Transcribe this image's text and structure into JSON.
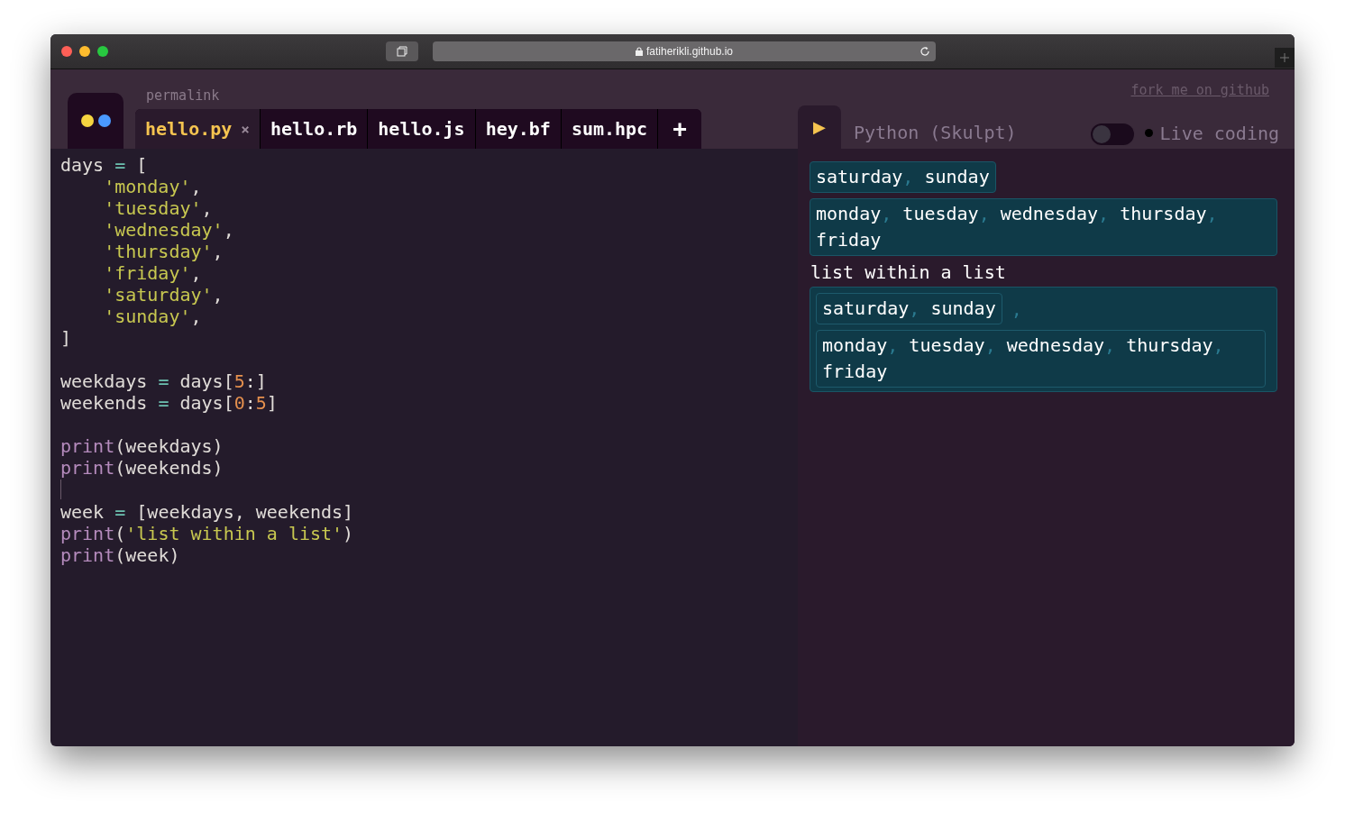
{
  "browser": {
    "address": "fatiherikli.github.io"
  },
  "header": {
    "permalink": "permalink",
    "fork_link": "fork me on github"
  },
  "tabs": [
    {
      "label": "hello.py",
      "selected": true,
      "close": "×"
    },
    {
      "label": "hello.rb",
      "selected": false
    },
    {
      "label": "hello.js",
      "selected": false
    },
    {
      "label": "hey.bf",
      "selected": false
    },
    {
      "label": "sum.hpc",
      "selected": false
    }
  ],
  "add_tab": "+",
  "editor": {
    "lines": [
      {
        "tokens": [
          {
            "kind": "plain",
            "text": "days "
          },
          {
            "kind": "op",
            "text": "="
          },
          {
            "kind": "plain",
            "text": " ["
          }
        ]
      },
      {
        "tokens": [
          {
            "kind": "string",
            "text": "    'monday'"
          },
          {
            "kind": "plain",
            "text": ","
          }
        ]
      },
      {
        "tokens": [
          {
            "kind": "string",
            "text": "    'tuesday'"
          },
          {
            "kind": "plain",
            "text": ","
          }
        ]
      },
      {
        "tokens": [
          {
            "kind": "string",
            "text": "    'wednesday'"
          },
          {
            "kind": "plain",
            "text": ","
          }
        ]
      },
      {
        "tokens": [
          {
            "kind": "string",
            "text": "    'thursday'"
          },
          {
            "kind": "plain",
            "text": ","
          }
        ]
      },
      {
        "tokens": [
          {
            "kind": "string",
            "text": "    'friday'"
          },
          {
            "kind": "plain",
            "text": ","
          }
        ]
      },
      {
        "tokens": [
          {
            "kind": "string",
            "text": "    'saturday'"
          },
          {
            "kind": "plain",
            "text": ","
          }
        ]
      },
      {
        "tokens": [
          {
            "kind": "string",
            "text": "    'sunday'"
          },
          {
            "kind": "plain",
            "text": ","
          }
        ]
      },
      {
        "tokens": [
          {
            "kind": "plain",
            "text": "]"
          }
        ]
      },
      {
        "kind": "blank"
      },
      {
        "tokens": [
          {
            "kind": "plain",
            "text": "weekdays "
          },
          {
            "kind": "op",
            "text": "="
          },
          {
            "kind": "plain",
            "text": " days["
          },
          {
            "kind": "number",
            "text": "5"
          },
          {
            "kind": "plain",
            "text": ":]"
          }
        ]
      },
      {
        "tokens": [
          {
            "kind": "plain",
            "text": "weekends "
          },
          {
            "kind": "op",
            "text": "="
          },
          {
            "kind": "plain",
            "text": " days["
          },
          {
            "kind": "number",
            "text": "0"
          },
          {
            "kind": "plain",
            "text": ":"
          },
          {
            "kind": "number",
            "text": "5"
          },
          {
            "kind": "plain",
            "text": "]"
          }
        ]
      },
      {
        "kind": "blank"
      },
      {
        "tokens": [
          {
            "kind": "builtin",
            "text": "print"
          },
          {
            "kind": "plain",
            "text": "(weekdays)"
          }
        ]
      },
      {
        "tokens": [
          {
            "kind": "builtin",
            "text": "print"
          },
          {
            "kind": "plain",
            "text": "(weekends)"
          }
        ]
      },
      {
        "kind": "cursor"
      },
      {
        "tokens": [
          {
            "kind": "plain",
            "text": "week "
          },
          {
            "kind": "op",
            "text": "="
          },
          {
            "kind": "plain",
            "text": " [weekdays, weekends]"
          }
        ]
      },
      {
        "tokens": [
          {
            "kind": "builtin",
            "text": "print"
          },
          {
            "kind": "plain",
            "text": "("
          },
          {
            "kind": "string",
            "text": "'list within a list'"
          },
          {
            "kind": "plain",
            "text": ")"
          }
        ]
      },
      {
        "tokens": [
          {
            "kind": "builtin",
            "text": "print"
          },
          {
            "kind": "plain",
            "text": "(week)"
          }
        ]
      }
    ]
  },
  "runner": {
    "run": "▶",
    "language": "Python (Skulpt)",
    "live_coding": {
      "label": "Live coding",
      "on": false
    }
  },
  "output": [
    {
      "kind": "list",
      "separator": ",",
      "items": [
        "saturday",
        "sunday"
      ]
    },
    {
      "kind": "list",
      "separator": ",",
      "items": [
        "monday",
        "tuesday",
        "wednesday",
        "thursday",
        "friday"
      ]
    },
    {
      "kind": "text",
      "text": "list within a list"
    },
    {
      "kind": "nested",
      "separator": ",",
      "lists": [
        {
          "items": [
            "saturday",
            "sunday"
          ]
        },
        {
          "items": [
            "monday",
            "tuesday",
            "wednesday",
            "thursday",
            "friday"
          ]
        }
      ]
    }
  ]
}
